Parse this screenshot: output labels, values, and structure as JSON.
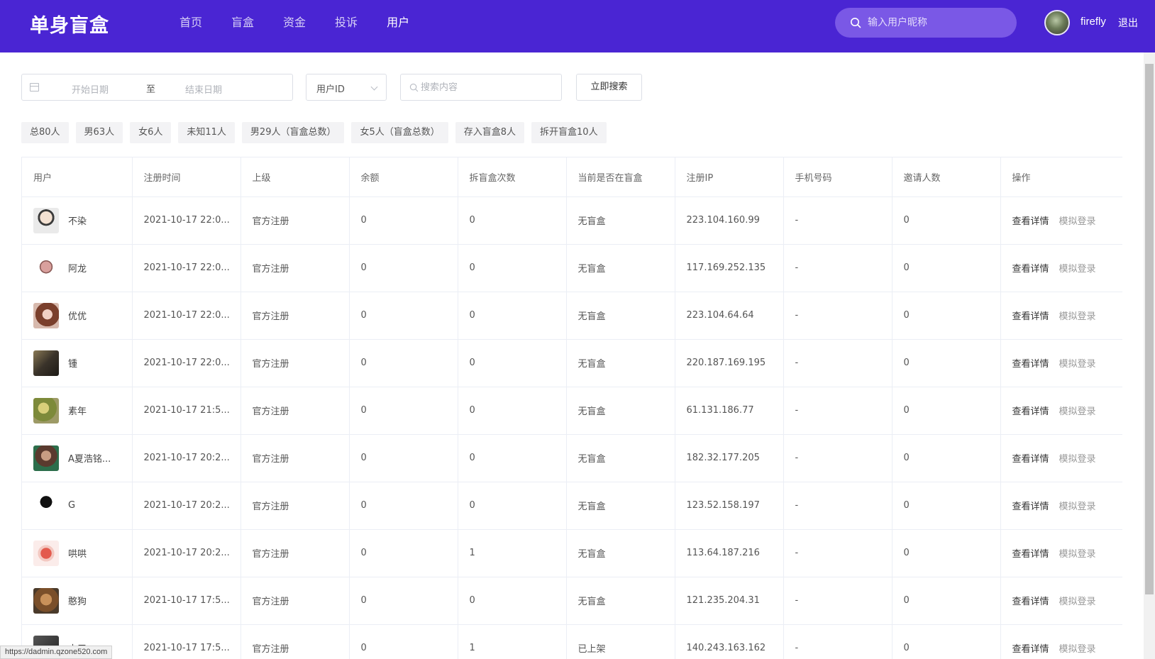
{
  "header": {
    "logo": "单身盲盒",
    "nav": [
      "首页",
      "盲盒",
      "资金",
      "投诉",
      "用户"
    ],
    "active_nav": "用户",
    "search_placeholder": "输入用户昵称",
    "username": "firefly",
    "logout": "退出",
    "accent_color": "#4a25d3"
  },
  "filters": {
    "date_start_placeholder": "开始日期",
    "date_separator": "至",
    "date_end_placeholder": "结束日期",
    "select_value": "用户ID",
    "search_placeholder": "搜索内容",
    "search_button": "立即搜索"
  },
  "stats": [
    "总80人",
    "男63人",
    "女6人",
    "未知11人",
    "男29人（盲盒总数）",
    "女5人（盲盒总数）",
    "存入盲盒8人",
    "拆开盲盒10人"
  ],
  "table": {
    "columns": [
      "用户",
      "注册时间",
      "上级",
      "余额",
      "拆盲盒次数",
      "当前是否在盲盒",
      "注册IP",
      "手机号码",
      "邀请人数",
      "操作"
    ],
    "action_detail": "查看详情",
    "action_login": "模拟登录",
    "rows": [
      {
        "name": "不染",
        "time": "2021-10-17 22:0...",
        "parent": "官方注册",
        "balance": "0",
        "opens": "0",
        "in_box": "无盲盒",
        "ip": "223.104.160.99",
        "phone": "-",
        "invites": "0",
        "avatar": "cartoon-glasses"
      },
      {
        "name": "阿龙",
        "time": "2021-10-17 22:0...",
        "parent": "官方注册",
        "balance": "0",
        "opens": "0",
        "in_box": "无盲盒",
        "ip": "117.169.252.135",
        "phone": "-",
        "invites": "0",
        "avatar": "pig-figure"
      },
      {
        "name": "优优",
        "time": "2021-10-17 22:0...",
        "parent": "官方注册",
        "balance": "0",
        "opens": "0",
        "in_box": "无盲盒",
        "ip": "223.104.64.64",
        "phone": "-",
        "invites": "0",
        "avatar": "girl-photo"
      },
      {
        "name": "锺",
        "time": "2021-10-17 22:0...",
        "parent": "官方注册",
        "balance": "0",
        "opens": "0",
        "in_box": "无盲盒",
        "ip": "220.187.169.195",
        "phone": "-",
        "invites": "0",
        "avatar": "dark-photo"
      },
      {
        "name": "素年",
        "time": "2021-10-17 21:5...",
        "parent": "官方注册",
        "balance": "0",
        "opens": "0",
        "in_box": "无盲盒",
        "ip": "61.131.186.77",
        "phone": "-",
        "invites": "0",
        "avatar": "flower-photo"
      },
      {
        "name": "A夏浩铭...",
        "time": "2021-10-17 20:2...",
        "parent": "官方注册",
        "balance": "0",
        "opens": "0",
        "in_box": "无盲盒",
        "ip": "182.32.177.205",
        "phone": "-",
        "invites": "0",
        "avatar": "man-photo"
      },
      {
        "name": "G",
        "time": "2021-10-17 20:2...",
        "parent": "官方注册",
        "balance": "0",
        "opens": "0",
        "in_box": "无盲盒",
        "ip": "123.52.158.197",
        "phone": "-",
        "invites": "0",
        "avatar": "black-silhouette"
      },
      {
        "name": "哄哄",
        "time": "2021-10-17 20:2...",
        "parent": "官方注册",
        "balance": "0",
        "opens": "1",
        "in_box": "无盲盒",
        "ip": "113.64.187.216",
        "phone": "-",
        "invites": "0",
        "avatar": "red-flower"
      },
      {
        "name": "憨狗",
        "time": "2021-10-17 17:5...",
        "parent": "官方注册",
        "balance": "0",
        "opens": "0",
        "in_box": "无盲盒",
        "ip": "121.235.204.31",
        "phone": "-",
        "invites": "0",
        "avatar": "dog-photo"
      },
      {
        "name": "十三",
        "time": "2021-10-17 17:5...",
        "parent": "官方注册",
        "balance": "0",
        "opens": "1",
        "in_box": "已上架",
        "ip": "140.243.163.162",
        "phone": "-",
        "invites": "0",
        "avatar": "dark-photo-2"
      }
    ]
  },
  "status_url": "https://dadmin.qzone520.com"
}
